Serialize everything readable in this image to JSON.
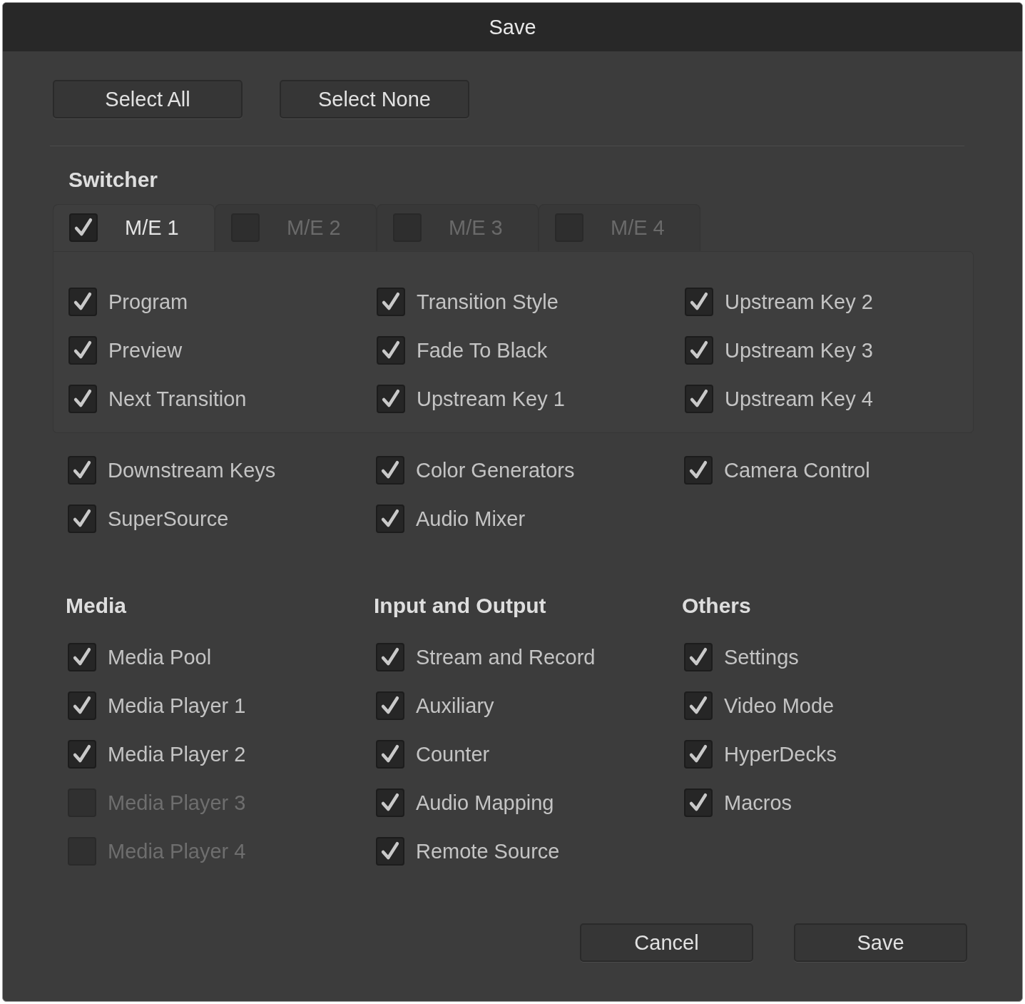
{
  "window": {
    "title": "Save"
  },
  "top_buttons": [
    "Select All",
    "Select None"
  ],
  "switcher": {
    "heading": "Switcher",
    "tabs": [
      {
        "label": "M/E 1",
        "selected": true,
        "checked": true,
        "disabled": false
      },
      {
        "label": "M/E 2",
        "selected": false,
        "checked": false,
        "disabled": true
      },
      {
        "label": "M/E 3",
        "selected": false,
        "checked": false,
        "disabled": true
      },
      {
        "label": "M/E 4",
        "selected": false,
        "checked": false,
        "disabled": true
      }
    ],
    "me_options": [
      {
        "label": "Program",
        "checked": true,
        "disabled": false
      },
      {
        "label": "Preview",
        "checked": true,
        "disabled": false
      },
      {
        "label": "Next Transition",
        "checked": true,
        "disabled": false
      },
      {
        "label": "Transition Style",
        "checked": true,
        "disabled": false
      },
      {
        "label": "Fade To Black",
        "checked": true,
        "disabled": false
      },
      {
        "label": "Upstream Key 1",
        "checked": true,
        "disabled": false
      },
      {
        "label": "Upstream Key 2",
        "checked": true,
        "disabled": false
      },
      {
        "label": "Upstream Key 3",
        "checked": true,
        "disabled": false
      },
      {
        "label": "Upstream Key 4",
        "checked": true,
        "disabled": false
      }
    ],
    "options": [
      {
        "label": "Downstream Keys",
        "checked": true,
        "disabled": false
      },
      {
        "label": "SuperSource",
        "checked": true,
        "disabled": false
      },
      {
        "label": "Color Generators",
        "checked": true,
        "disabled": false
      },
      {
        "label": "Audio Mixer",
        "checked": true,
        "disabled": false
      },
      {
        "label": "Camera Control",
        "checked": true,
        "disabled": false
      }
    ]
  },
  "sections": [
    {
      "heading": "Media",
      "items": [
        {
          "label": "Media Pool",
          "checked": true,
          "disabled": false
        },
        {
          "label": "Media Player 1",
          "checked": true,
          "disabled": false
        },
        {
          "label": "Media Player 2",
          "checked": true,
          "disabled": false
        },
        {
          "label": "Media Player 3",
          "checked": false,
          "disabled": true
        },
        {
          "label": "Media Player 4",
          "checked": false,
          "disabled": true
        }
      ]
    },
    {
      "heading": "Input and Output",
      "items": [
        {
          "label": "Stream and Record",
          "checked": true,
          "disabled": false
        },
        {
          "label": "Auxiliary",
          "checked": true,
          "disabled": false
        },
        {
          "label": "Counter",
          "checked": true,
          "disabled": false
        },
        {
          "label": "Audio Mapping",
          "checked": true,
          "disabled": false
        },
        {
          "label": "Remote Source",
          "checked": true,
          "disabled": false
        }
      ]
    },
    {
      "heading": "Others",
      "items": [
        {
          "label": "Settings",
          "checked": true,
          "disabled": false
        },
        {
          "label": "Video Mode",
          "checked": true,
          "disabled": false
        },
        {
          "label": "HyperDecks",
          "checked": true,
          "disabled": false
        },
        {
          "label": "Macros",
          "checked": true,
          "disabled": false
        }
      ]
    }
  ],
  "bottom_buttons": [
    "Cancel",
    "Save"
  ]
}
